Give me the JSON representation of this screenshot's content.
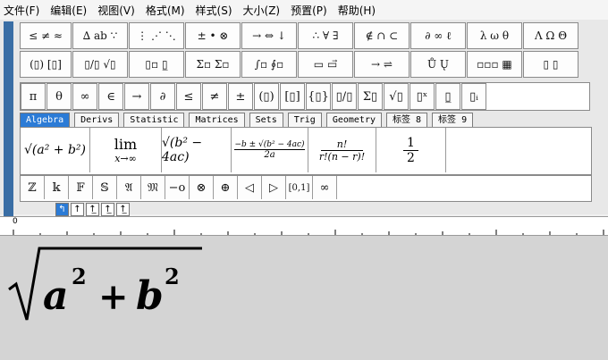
{
  "menu": [
    "文件(F)",
    "编辑(E)",
    "视图(V)",
    "格式(M)",
    "样式(S)",
    "大小(Z)",
    "预置(P)",
    "帮助(H)"
  ],
  "toolbar_row1": [
    "≤ ≠ ≈",
    "∆ ab ∵",
    "⋮ ⋰ ⋱",
    "± • ⊗",
    "→ ⇔ ↓",
    "∴ ∀ ∃",
    "∉ ∩ ⊂",
    "∂ ∞ ℓ",
    "λ ω θ",
    "Λ Ω Θ"
  ],
  "toolbar_row2": [
    "(▯) [▯]",
    "▯/▯ √▯",
    "▯▫ ▯̲",
    "Σ▫ Σ▫",
    "∫▫ ∮▫",
    "▭ ▭⃗",
    "→ ⇌",
    "Ů Ų",
    "▫▫▫ ▦",
    "▯ ▯"
  ],
  "toolbar_row3": [
    "π",
    "θ",
    "∞",
    "∈",
    "→",
    "∂",
    "≤",
    "≠",
    "±",
    "(▯)",
    "[▯]",
    "{▯}",
    "▯/▯",
    "Σ▯",
    "√▯",
    "▯ˣ",
    "▯̲",
    "▯ᵢ"
  ],
  "tabs": [
    "Algebra",
    "Derivs",
    "Statistic",
    "Matrices",
    "Sets",
    "Trig",
    "Geometry",
    "标签 8",
    "标签 9"
  ],
  "templates": {
    "t1": "√(a² + b²)",
    "t2_top": "lim",
    "t2_bottom": "x→∞",
    "t3": "√(b² − 4ac)",
    "t4_top": "−b ± √(b² − 4ac)",
    "t4_bottom": "2a",
    "t5_top": "n!",
    "t5_bottom": "r!(n − r)!",
    "t6_top": "1",
    "t6_bottom": "2"
  },
  "row5": [
    "ℤ",
    "𝕜",
    "𝔽",
    "𝕊",
    "𝔄",
    "𝔐",
    "−o",
    "⊗",
    "⊕",
    "◁",
    "▷",
    "[0,1]",
    "∞"
  ],
  "nudge": [
    "↰",
    "↑",
    "↑̲",
    "↑̲",
    "↑̲"
  ],
  "ruler_label": "0",
  "formula": {
    "a": "a",
    "b": "b",
    "exp": "2",
    "plus": "+"
  }
}
